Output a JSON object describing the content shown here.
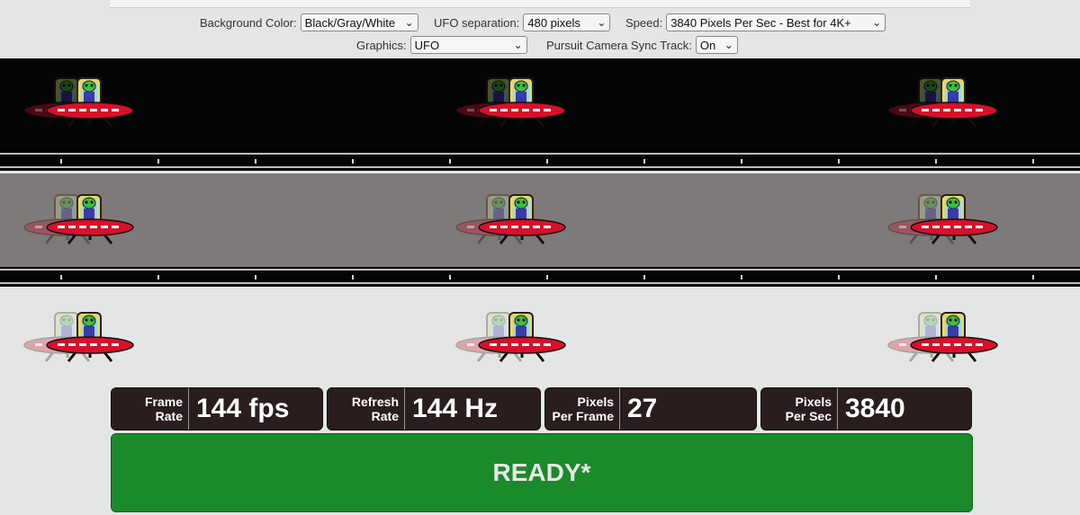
{
  "controls": {
    "background_color": {
      "label": "Background Color:",
      "value": "Black/Gray/White"
    },
    "ufo_separation": {
      "label": "UFO separation:",
      "value": "480 pixels"
    },
    "speed": {
      "label": "Speed:",
      "value": "3840 Pixels Per Sec - Best for 4K+"
    },
    "graphics": {
      "label": "Graphics:",
      "value": "UFO"
    },
    "pursuit_camera": {
      "label": "Pursuit Camera Sync Track:",
      "value": "On"
    }
  },
  "stats": {
    "frame_rate": {
      "label_1": "Frame",
      "label_2": "Rate",
      "value": "144 fps"
    },
    "refresh_rate": {
      "label_1": "Refresh",
      "label_2": "Rate",
      "value": "144 Hz"
    },
    "pixels_per_frame": {
      "label_1": "Pixels",
      "label_2": "Per Frame",
      "value": "27"
    },
    "pixels_per_sec": {
      "label_1": "Pixels",
      "label_2": "Per Sec",
      "value": "3840"
    }
  },
  "status": {
    "text": "READY*"
  },
  "colors": {
    "ready_green": "#1a8a2a",
    "stat_bg": "#2a1d1e",
    "ufo_red": "#d8102a",
    "alien_green": "#3fbf3f"
  },
  "icons": {
    "ufo": "ufo-alien-icon",
    "chevron": "chevron-down-icon"
  }
}
